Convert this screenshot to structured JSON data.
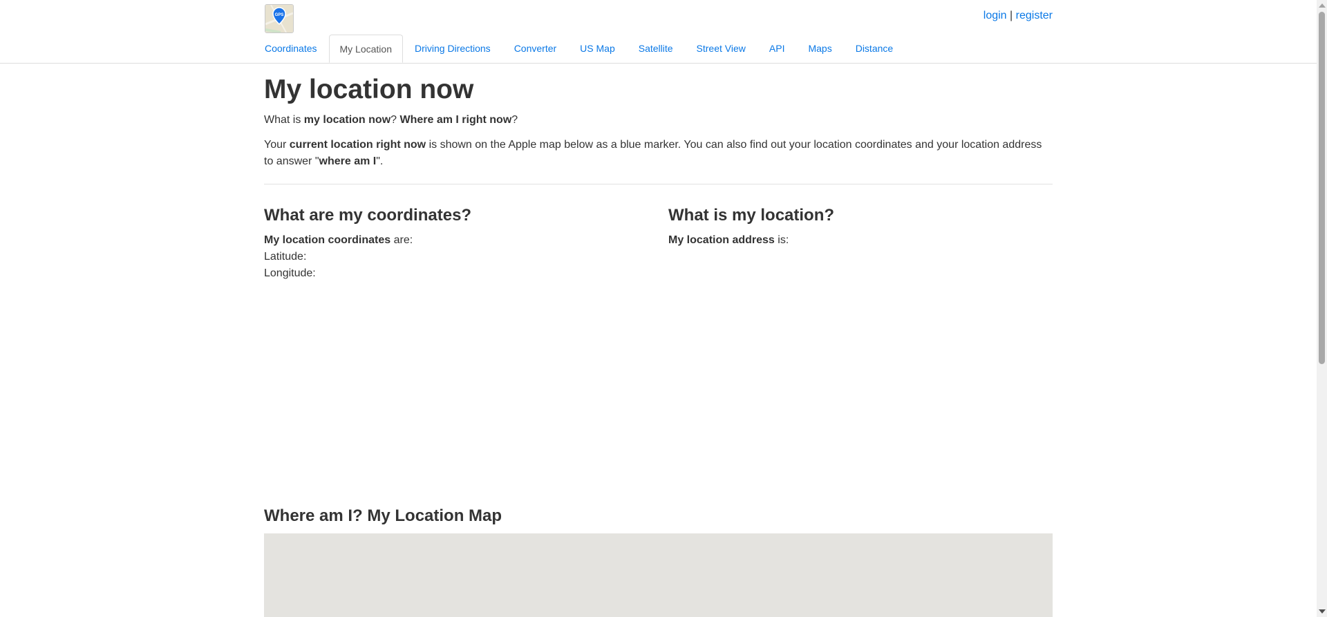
{
  "header": {
    "logo_text": "GPS",
    "login_label": "login",
    "separator": "|",
    "register_label": "register"
  },
  "nav": {
    "tabs": [
      {
        "label": "Coordinates"
      },
      {
        "label": "My Location"
      },
      {
        "label": "Driving Directions"
      },
      {
        "label": "Converter"
      },
      {
        "label": "US Map"
      },
      {
        "label": "Satellite"
      },
      {
        "label": "Street View"
      },
      {
        "label": "API"
      },
      {
        "label": "Maps"
      },
      {
        "label": "Distance"
      }
    ],
    "active_tab": "My Location"
  },
  "main": {
    "title": "My location now",
    "question": {
      "t1": "What is ",
      "b1": "my location now",
      "t2": "? ",
      "b2": "Where am I right now",
      "t3": "?"
    },
    "intro": {
      "t1": "Your ",
      "b1": "current location right now",
      "t2": " is shown on the Apple map below as a blue marker. You can also find out your location coordinates and your location address to answer \"",
      "b2": "where am I",
      "t3": "\"."
    },
    "coordinates": {
      "heading": "What are my coordinates?",
      "label_bold": "My location coordinates",
      "label_rest": " are:",
      "latitude_label": "Latitude:",
      "latitude_value": "",
      "longitude_label": "Longitude:",
      "longitude_value": ""
    },
    "address": {
      "heading": "What is my location?",
      "label_bold": "My location address",
      "label_rest": " is:",
      "value": ""
    },
    "map_heading": "Where am I? My Location Map"
  },
  "colors": {
    "link": "#0a78e6",
    "text": "#333333",
    "map_bg": "#e4e3df",
    "marker": "#1a73e8"
  }
}
